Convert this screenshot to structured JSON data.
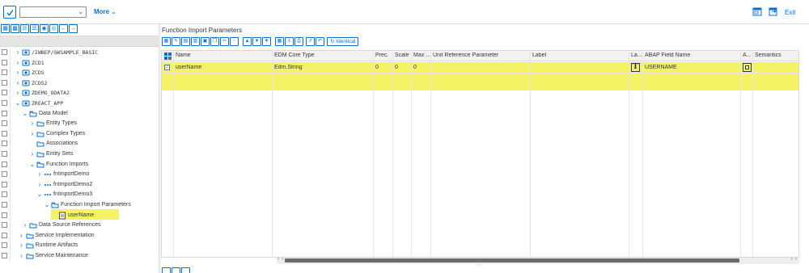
{
  "toolbar": {
    "more_label": "More",
    "exit_label": "Exit",
    "command_field_value": ""
  },
  "tree": {
    "rows": [
      {
        "label": "/IWBEP/GWSAMPLE_BASIC",
        "mono": true
      },
      {
        "label": "ZCD1",
        "mono": true
      },
      {
        "label": "ZCDS",
        "mono": true
      },
      {
        "label": "ZCDS2",
        "mono": true
      },
      {
        "label": "ZDEMO_ODATA2",
        "mono": true
      },
      {
        "label": "ZREACT_APP",
        "mono": true
      },
      {
        "label": "Data Model"
      },
      {
        "label": "Entity Types"
      },
      {
        "label": "Complex Types"
      },
      {
        "label": "Associations"
      },
      {
        "label": "Entity Sets"
      },
      {
        "label": "Function Imports"
      },
      {
        "label": "fnImportDemo"
      },
      {
        "label": "fnImportDemo2"
      },
      {
        "label": "fnImportDemo3"
      },
      {
        "label": "Function Import Parameters"
      },
      {
        "label": "userName"
      },
      {
        "label": "Data Source References"
      },
      {
        "label": "Service Implementation"
      },
      {
        "label": "Runtime Artifacts"
      },
      {
        "label": "Service Maintenance"
      }
    ]
  },
  "right_pane": {
    "title": "Function Import Parameters",
    "identical_label": "Identical"
  },
  "grid": {
    "columns": [
      "Name",
      "EDM Core Type",
      "Prec.",
      "Scale",
      "Max ...",
      "Unit Reference Parameter",
      "Label",
      "La...",
      "ABAP Field Name",
      "A...",
      "Semantics"
    ],
    "rows": [
      {
        "name": "userName",
        "edm_core_type": "Edm.String",
        "precision": "0",
        "scale": "0",
        "max_length": "0",
        "unit_reference_parameter": "",
        "label": "",
        "abap_field_name": "USERNAME",
        "semantics": ""
      }
    ]
  },
  "colors": {
    "accent": "#0a6ed1",
    "highlight": "#f4f265",
    "header_bg": "#f2f2f2"
  }
}
